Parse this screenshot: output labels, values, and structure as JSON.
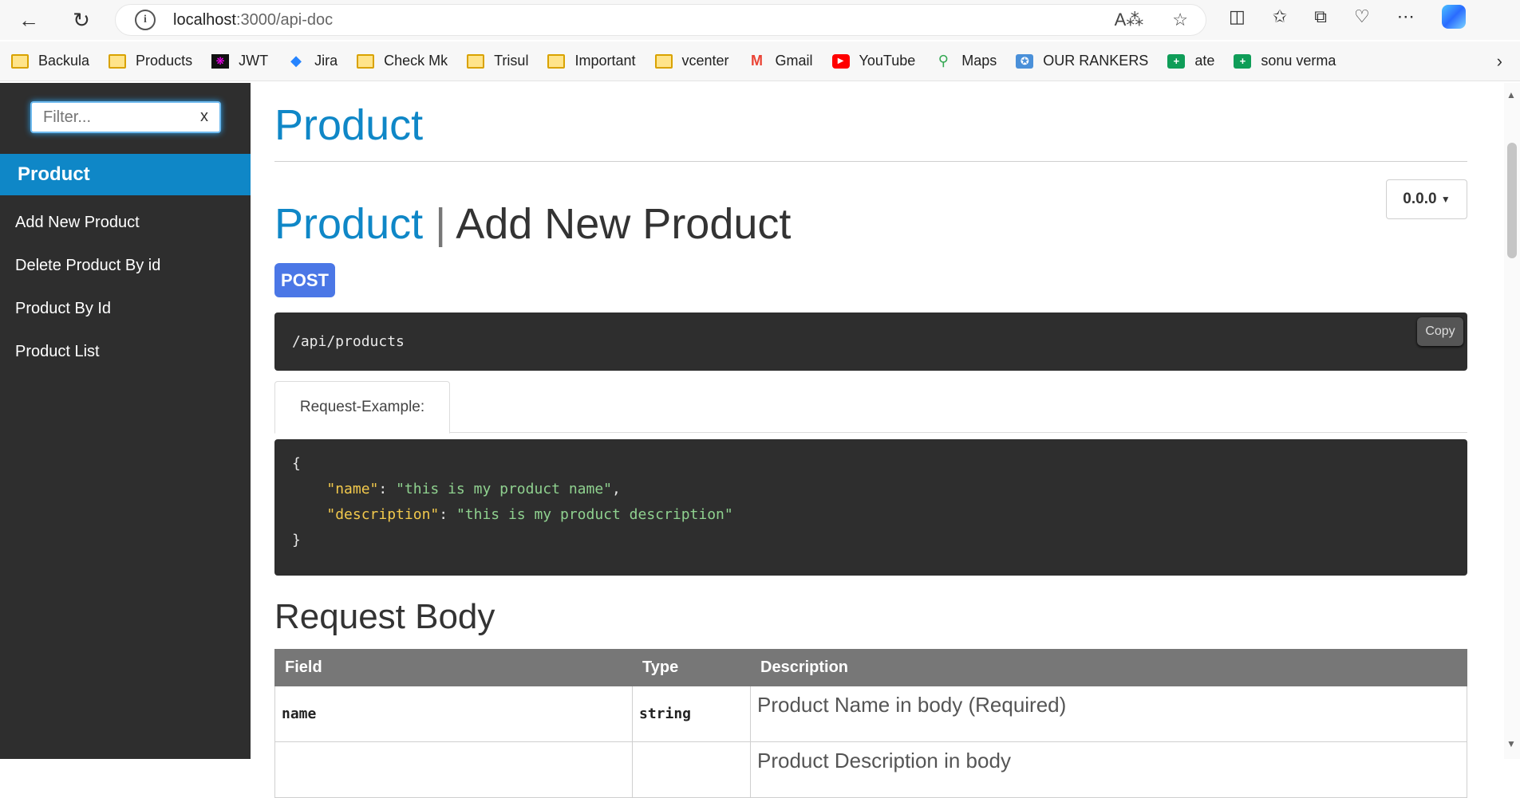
{
  "browser": {
    "url_host": "localhost",
    "url_rest": ":3000/api-doc",
    "bookmarks": [
      "Backula",
      "Products",
      "JWT",
      "Jira",
      "Check Mk",
      "Trisul",
      "Important",
      "vcenter",
      "Gmail",
      "YouTube",
      "Maps",
      "OUR RANKERS",
      "ate",
      "sonu verma"
    ]
  },
  "sidebar": {
    "filter_placeholder": "Filter...",
    "filter_clear": "x",
    "group": "Product",
    "items": [
      "Add New Product",
      "Delete Product By id",
      "Product By Id",
      "Product List"
    ]
  },
  "main": {
    "title": "Product",
    "version": "0.0.0",
    "endpoint_group": "Product",
    "endpoint_sep": "|",
    "endpoint_name": "Add New Product",
    "method": "POST",
    "path": "/api/products",
    "copy_label": "Copy",
    "tab_label": "Request-Example:",
    "example": {
      "open": "{",
      "name_key": "\"name\"",
      "name_val": "\"this is my product name\"",
      "desc_key": "\"description\"",
      "desc_val": "\"this is my product description\"",
      "close": "}"
    },
    "body_heading": "Request Body",
    "table": {
      "headers": [
        "Field",
        "Type",
        "Description"
      ],
      "rows": [
        {
          "field": "name",
          "type": "string",
          "description": "Product Name in body (Required)"
        },
        {
          "field": "",
          "type": "",
          "description": "Product Description in body"
        }
      ]
    }
  },
  "colors": {
    "accent": "#0f87c7",
    "post": "#4b77e6",
    "code_bg": "#2e2e2e"
  }
}
